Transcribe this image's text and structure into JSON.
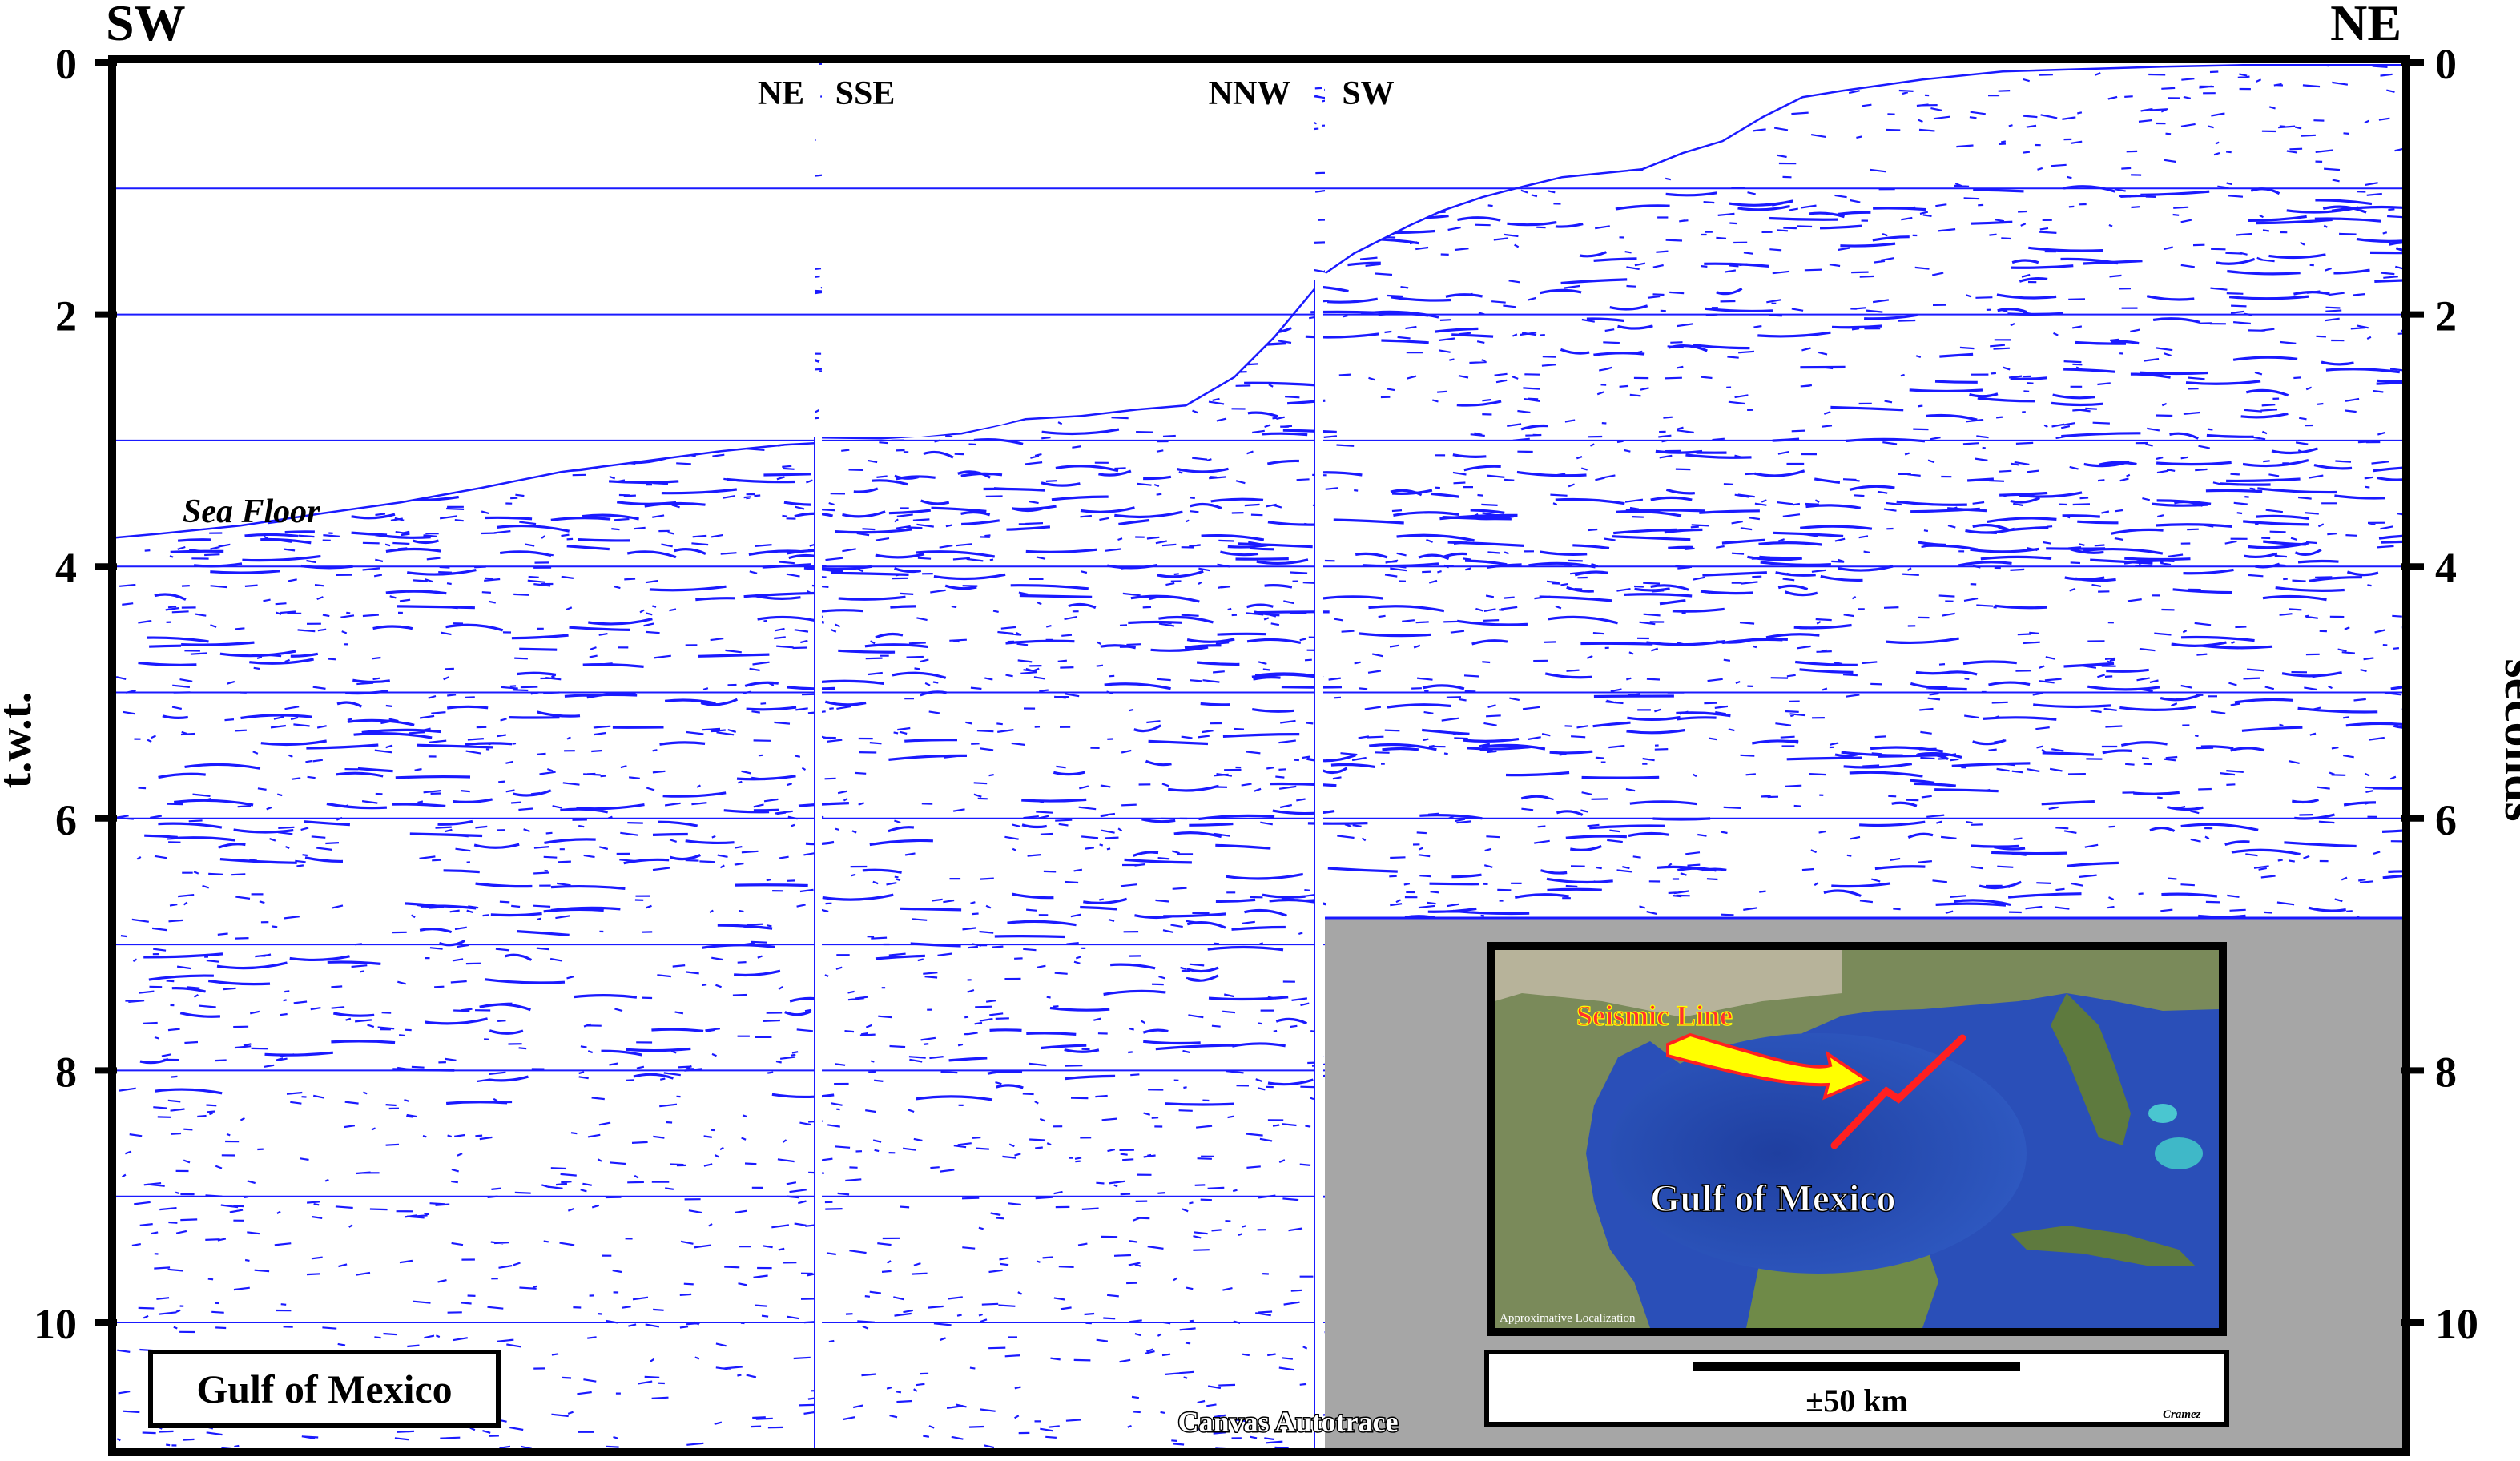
{
  "section": {
    "left_direction": "SW",
    "right_direction": "NE",
    "segment_labels": [
      "NE",
      "SSE",
      "NNW",
      "SW"
    ],
    "sea_floor_label": "Sea Floor",
    "left_axis_label": "t.w.t.",
    "right_axis_label": "seconds",
    "y_ticks": [
      "0",
      "2",
      "4",
      "6",
      "8",
      "10"
    ],
    "y_axis_range_seconds": [
      0,
      11
    ],
    "title_box": "Gulf of Mexico",
    "software_credit": "Canvas Autotrace",
    "trace_color": "#1a1aff"
  },
  "inset_map": {
    "seismic_line_label": "Seismic Line",
    "place_label": "Gulf of Mexico",
    "localization_note": "Approximative Localization",
    "scale_label": "±50 km",
    "author": "Cramez",
    "line_color": "#ff2020",
    "arrow_fill": "#ffff00",
    "panel_background": "#a6a6a6"
  }
}
